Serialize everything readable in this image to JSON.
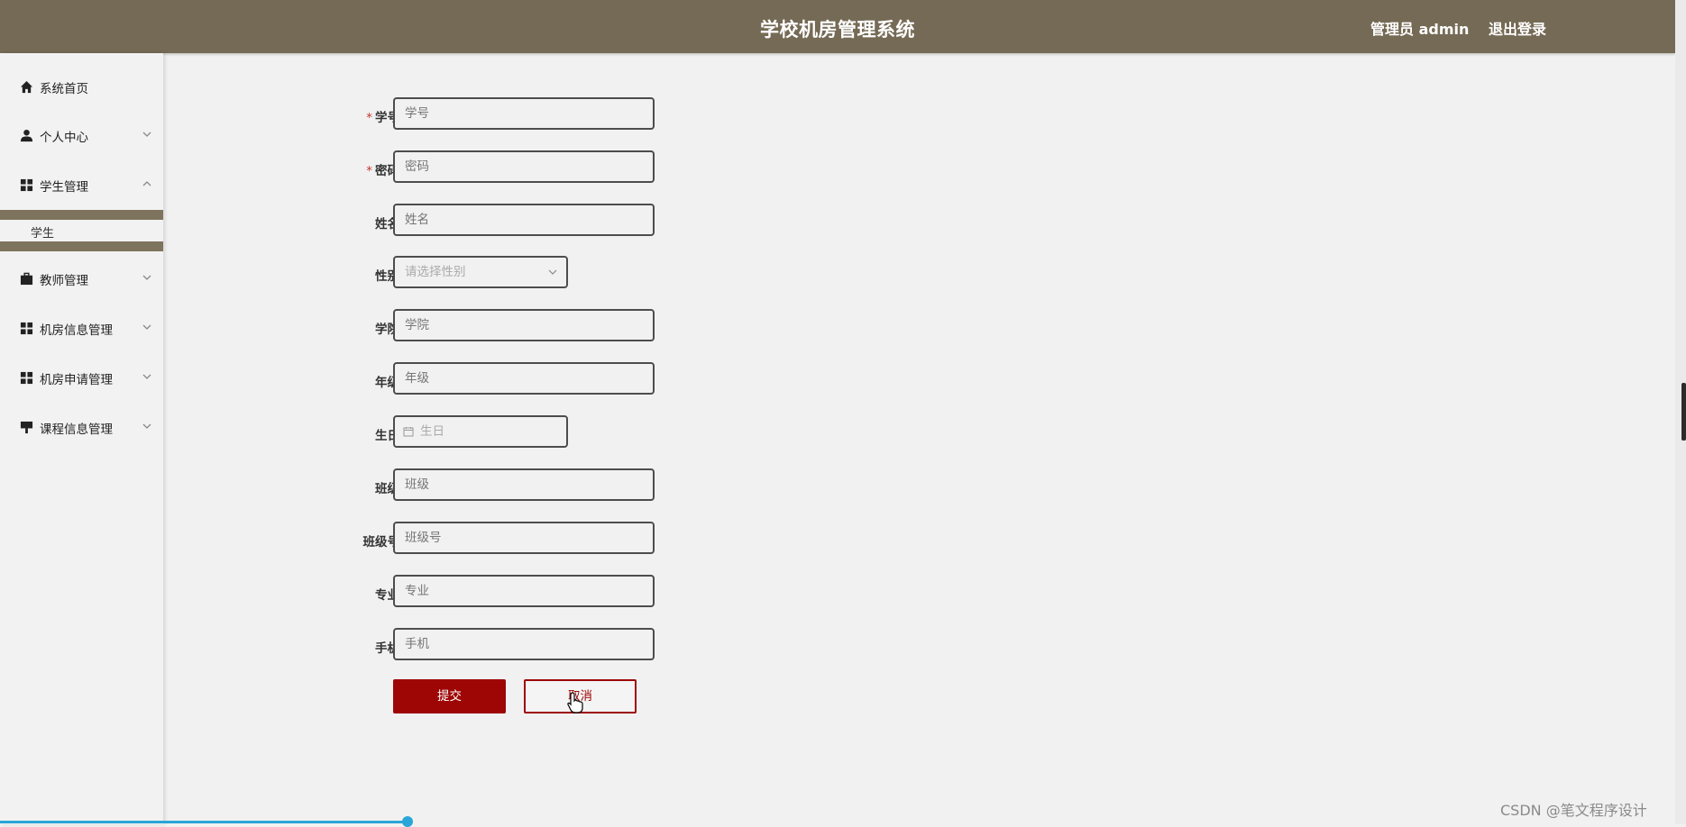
{
  "header": {
    "title": "学校机房管理系统",
    "user": "管理员 admin",
    "logout": "退出登录"
  },
  "sidebar": {
    "items": [
      {
        "label": "系统首页",
        "icon": "home-icon"
      },
      {
        "label": "个人中心",
        "icon": "user-icon"
      },
      {
        "label": "学生管理",
        "icon": "grid-icon"
      },
      {
        "label": "教师管理",
        "icon": "briefcase-icon"
      },
      {
        "label": "机房信息管理",
        "icon": "grid-icon"
      },
      {
        "label": "机房申请管理",
        "icon": "grid-icon"
      },
      {
        "label": "课程信息管理",
        "icon": "flag-icon"
      }
    ],
    "submenu": {
      "label": "学生"
    }
  },
  "form": {
    "fields": [
      {
        "label": "学号",
        "placeholder": "学号",
        "required": true
      },
      {
        "label": "密码",
        "placeholder": "密码",
        "required": true
      },
      {
        "label": "姓名",
        "placeholder": "姓名"
      },
      {
        "label": "性别",
        "placeholder": "请选择性别",
        "type": "select"
      },
      {
        "label": "学院",
        "placeholder": "学院"
      },
      {
        "label": "年级",
        "placeholder": "年级"
      },
      {
        "label": "生日",
        "placeholder": "生日",
        "type": "date"
      },
      {
        "label": "班级",
        "placeholder": "班级"
      },
      {
        "label": "班级号",
        "placeholder": "班级号"
      },
      {
        "label": "专业",
        "placeholder": "专业"
      },
      {
        "label": "手机",
        "placeholder": "手机"
      }
    ],
    "required_mark": "*",
    "submit": "提交",
    "cancel": "取消"
  },
  "watermark": "CSDN @笔文程序设计",
  "colors": {
    "header_bg": "#756a55",
    "submit_bg": "#9e0606",
    "required": "#c0392b"
  }
}
